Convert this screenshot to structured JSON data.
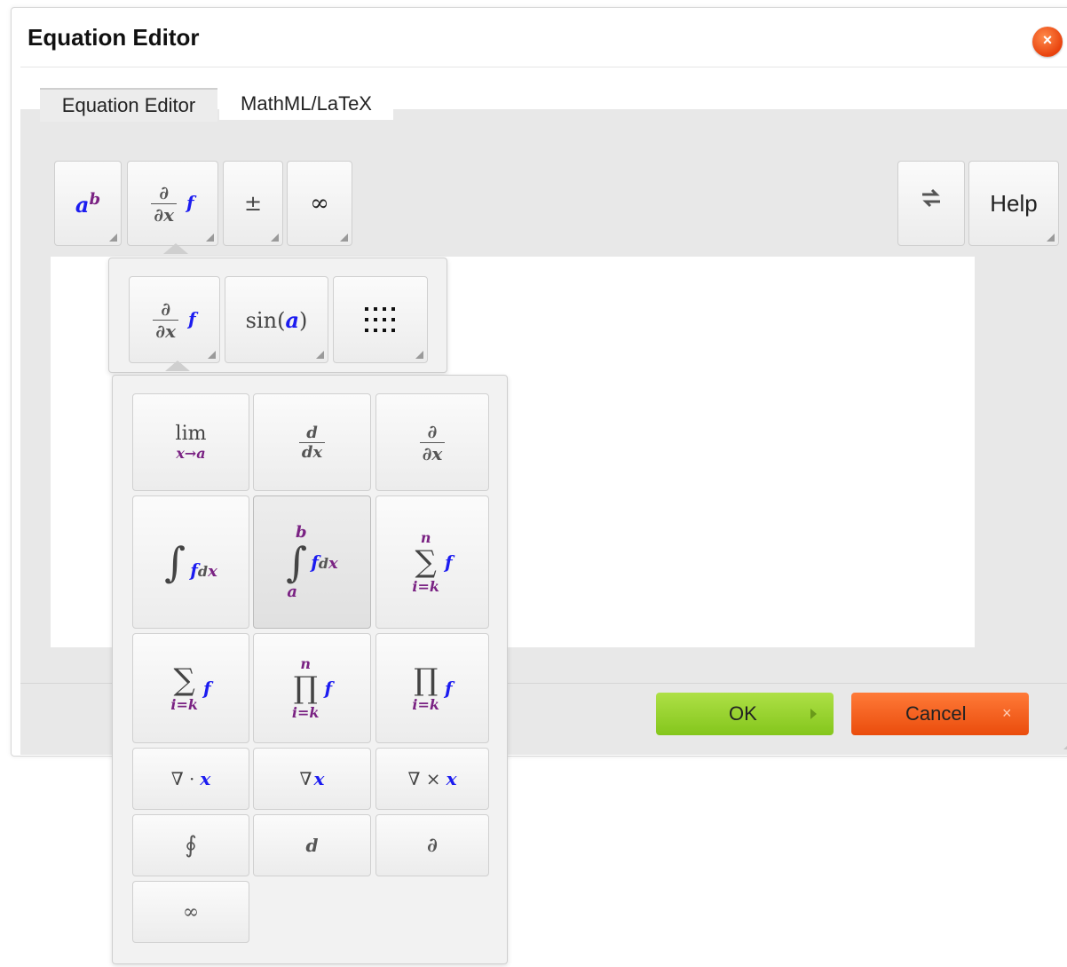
{
  "dialog": {
    "title": "Equation Editor",
    "close_icon": "close-icon"
  },
  "tabs": [
    {
      "label": "Equation Editor",
      "active": true
    },
    {
      "label": "MathML/LaTeX",
      "active": false
    }
  ],
  "toolbar": {
    "superscript": {
      "base": "a",
      "exp": "b"
    },
    "derivative": {
      "num": "∂",
      "den": "∂x",
      "fn": "f"
    },
    "plusminus": "±",
    "infinity": "∞",
    "swap_icon": "swap-icon",
    "help_label": "Help"
  },
  "calculus_menu": {
    "derivative": {
      "num": "∂",
      "den": "∂x",
      "fn": "f"
    },
    "sin": "sin",
    "sin_arg": "a",
    "matrix_icon": "matrix-icon"
  },
  "calculus_palette": {
    "limit": {
      "op": "lim",
      "sub": "x→a"
    },
    "d_dx": {
      "num": "d",
      "den": "dx"
    },
    "partial_dx": {
      "num": "∂",
      "den": "∂x"
    },
    "integral": {
      "sym": "∫",
      "fn": "f",
      "d": "d",
      "var": "x"
    },
    "def_integral": {
      "sym": "∫",
      "upper": "b",
      "lower": "a",
      "fn": "f",
      "d": "d",
      "var": "x"
    },
    "sum_bounds": {
      "sym": "∑",
      "upper": "n",
      "lower": "i=k",
      "fn": "f"
    },
    "sum_lower": {
      "sym": "∑",
      "lower": "i=k",
      "fn": "f"
    },
    "prod_bounds": {
      "sym": "∏",
      "upper": "n",
      "lower": "i=k",
      "fn": "f"
    },
    "prod_lower": {
      "sym": "∏",
      "lower": "i=k",
      "fn": "f"
    },
    "divergence": {
      "op": "∇ ·",
      "var": "x"
    },
    "gradient": {
      "op": "∇",
      "var": "x"
    },
    "curl": {
      "op": "∇ ×",
      "var": "x"
    },
    "contour": "∮",
    "d": "d",
    "partial": "∂",
    "infinity": "∞"
  },
  "footer": {
    "ok_label": "OK",
    "cancel_label": "Cancel"
  },
  "colors": {
    "ok": "#95d22c",
    "cancel": "#f05a17",
    "math_purple": "#7a2283",
    "math_blue": "#1c1cf0"
  }
}
